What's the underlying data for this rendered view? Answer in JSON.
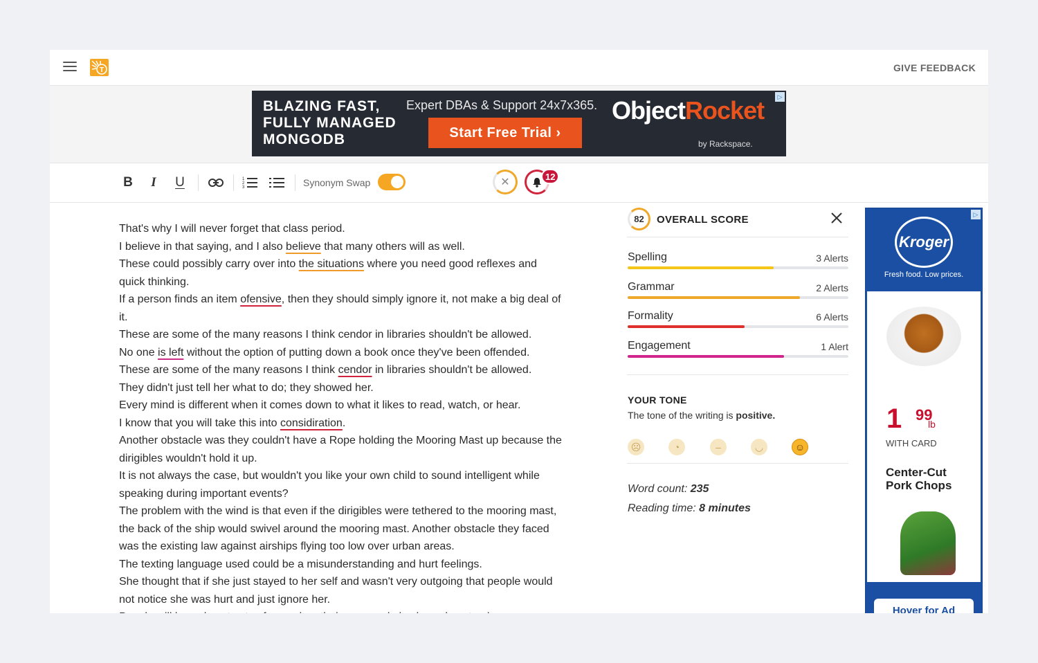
{
  "topbar": {
    "give_feedback": "GIVE FEEDBACK"
  },
  "banner_ad": {
    "headline": [
      "BLAZING FAST,",
      "FULLY MANAGED",
      "MONGODB"
    ],
    "subtext": "Expert DBAs & Support 24x7x365.",
    "cta": "Start Free Trial ›",
    "brand_a": "Object",
    "brand_b": "Rocket",
    "byline": "by Rackspace."
  },
  "toolbar": {
    "bold": "B",
    "italic": "I",
    "underline": "U",
    "synonym_swap": "Synonym Swap",
    "synonym_swap_on": true,
    "notification_count": "12"
  },
  "editor": {
    "paragraphs": [
      [
        {
          "t": "That's why I will never forget that class period."
        }
      ],
      [
        {
          "t": "I believe in that saying, and I also "
        },
        {
          "t": "believe",
          "u": "or"
        },
        {
          "t": " that many others will as well."
        }
      ],
      [
        {
          "t": "These could possibly carry over into "
        },
        {
          "t": "the situations",
          "u": "or"
        },
        {
          "t": " where you need good reflexes and quick thinking."
        }
      ],
      [
        {
          "t": "If a person finds an item "
        },
        {
          "t": "ofensive",
          "u": "red"
        },
        {
          "t": ", then they should simply ignore it, not make a big deal of it."
        }
      ],
      [
        {
          "t": "These are some of the many reasons I think cendor in libraries shouldn't be allowed."
        }
      ],
      [
        {
          "t": "No one "
        },
        {
          "t": "is left",
          "u": "pink"
        },
        {
          "t": " without the option of putting down a book once they've been offended."
        }
      ],
      [
        {
          "t": "These are some of the many reasons I think "
        },
        {
          "t": "cendor",
          "u": "red"
        },
        {
          "t": " in libraries shouldn't be allowed."
        }
      ],
      [
        {
          "t": "They didn't just tell her what to do; they showed her."
        }
      ],
      [
        {
          "t": "Every mind is different when it comes down to what it likes to read, watch, or hear."
        }
      ],
      [
        {
          "t": "I know that you will take this into "
        },
        {
          "t": "considiration",
          "u": "red"
        },
        {
          "t": "."
        }
      ],
      [
        {
          "t": "Another obstacle was they couldn't have a Rope holding the Mooring Mast up because the dirigibles wouldn't hold it up."
        }
      ],
      [
        {
          "t": "It is not always the case, but wouldn't you like your own child to sound intelligent while speaking during important events?"
        }
      ],
      [
        {
          "t": "The problem with the wind is that even if the dirigibles were tethered to the mooring mast, the back of the ship would swivel around the mooring mast. Another obstacle they faced was the existing law against airships flying too low over urban areas."
        }
      ],
      [
        {
          "t": "The texting language used could be a misunderstanding and hurt feelings."
        }
      ],
      [
        {
          "t": "She thought that if she just stayed to her self and wasn't very outgoing that people would not notice she was hurt and just ignore her."
        }
      ],
      [
        {
          "t": "People will know how to stay focused on their eyes and also know how to also use"
        }
      ]
    ]
  },
  "score_panel": {
    "score": "82",
    "title": "OVERALL SCORE",
    "metrics": [
      {
        "name": "Spelling",
        "count": "3 Alerts",
        "fill": 0.66,
        "color": "#f5c518"
      },
      {
        "name": "Grammar",
        "count": "2 Alerts",
        "fill": 0.78,
        "color": "#f0a82a"
      },
      {
        "name": "Formality",
        "count": "6 Alerts",
        "fill": 0.53,
        "color": "#e0302d"
      },
      {
        "name": "Engagement",
        "count": "1 Alert",
        "fill": 0.71,
        "color": "#d1278d"
      }
    ],
    "tone_title": "YOUR TONE",
    "tone_text_prefix": "The tone of the writing is ",
    "tone_value": "positive.",
    "tone_selected_index": 4,
    "word_count_label": "Word count: ",
    "word_count": "235",
    "reading_time_label": "Reading time: ",
    "reading_time": "8 minutes"
  },
  "side_ad": {
    "brand": "Kroger",
    "tagline": "Fresh food. Low prices.",
    "price_main": "1",
    "price_cents": "99",
    "price_unit": "lb",
    "with_card": "WITH CARD",
    "product_line1": "Center-Cut",
    "product_line2": "Pork Chops",
    "cta": "Hover for Ad"
  }
}
